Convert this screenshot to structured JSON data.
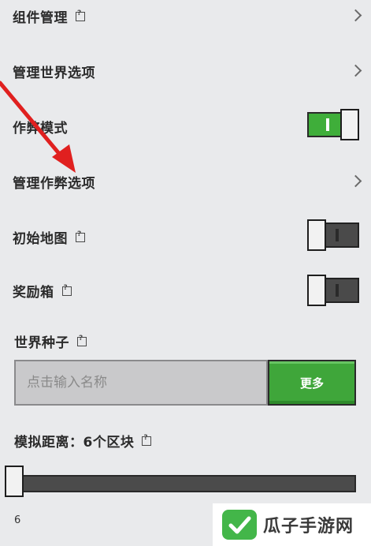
{
  "settings": {
    "component_management": {
      "label": "组件管理"
    },
    "manage_world_options": {
      "label": "管理世界选项"
    },
    "cheat_mode": {
      "label": "作弊模式",
      "enabled": true
    },
    "manage_cheat_options": {
      "label": "管理作弊选项"
    },
    "starting_map": {
      "label": "初始地图",
      "enabled": false
    },
    "bonus_chest": {
      "label": "奖励箱",
      "enabled": false
    },
    "world_seed": {
      "label": "世界种子",
      "placeholder": "点击输入名称",
      "value": "",
      "more_button": "更多"
    },
    "simulation_distance": {
      "label": "模拟距离：6个区块",
      "value": "6",
      "level": 0
    }
  },
  "watermark": {
    "text": "瓜子手游网"
  },
  "colors": {
    "accent_green": "#3fae3a",
    "background": "#e9eaec",
    "arrow": "#e0201f"
  }
}
